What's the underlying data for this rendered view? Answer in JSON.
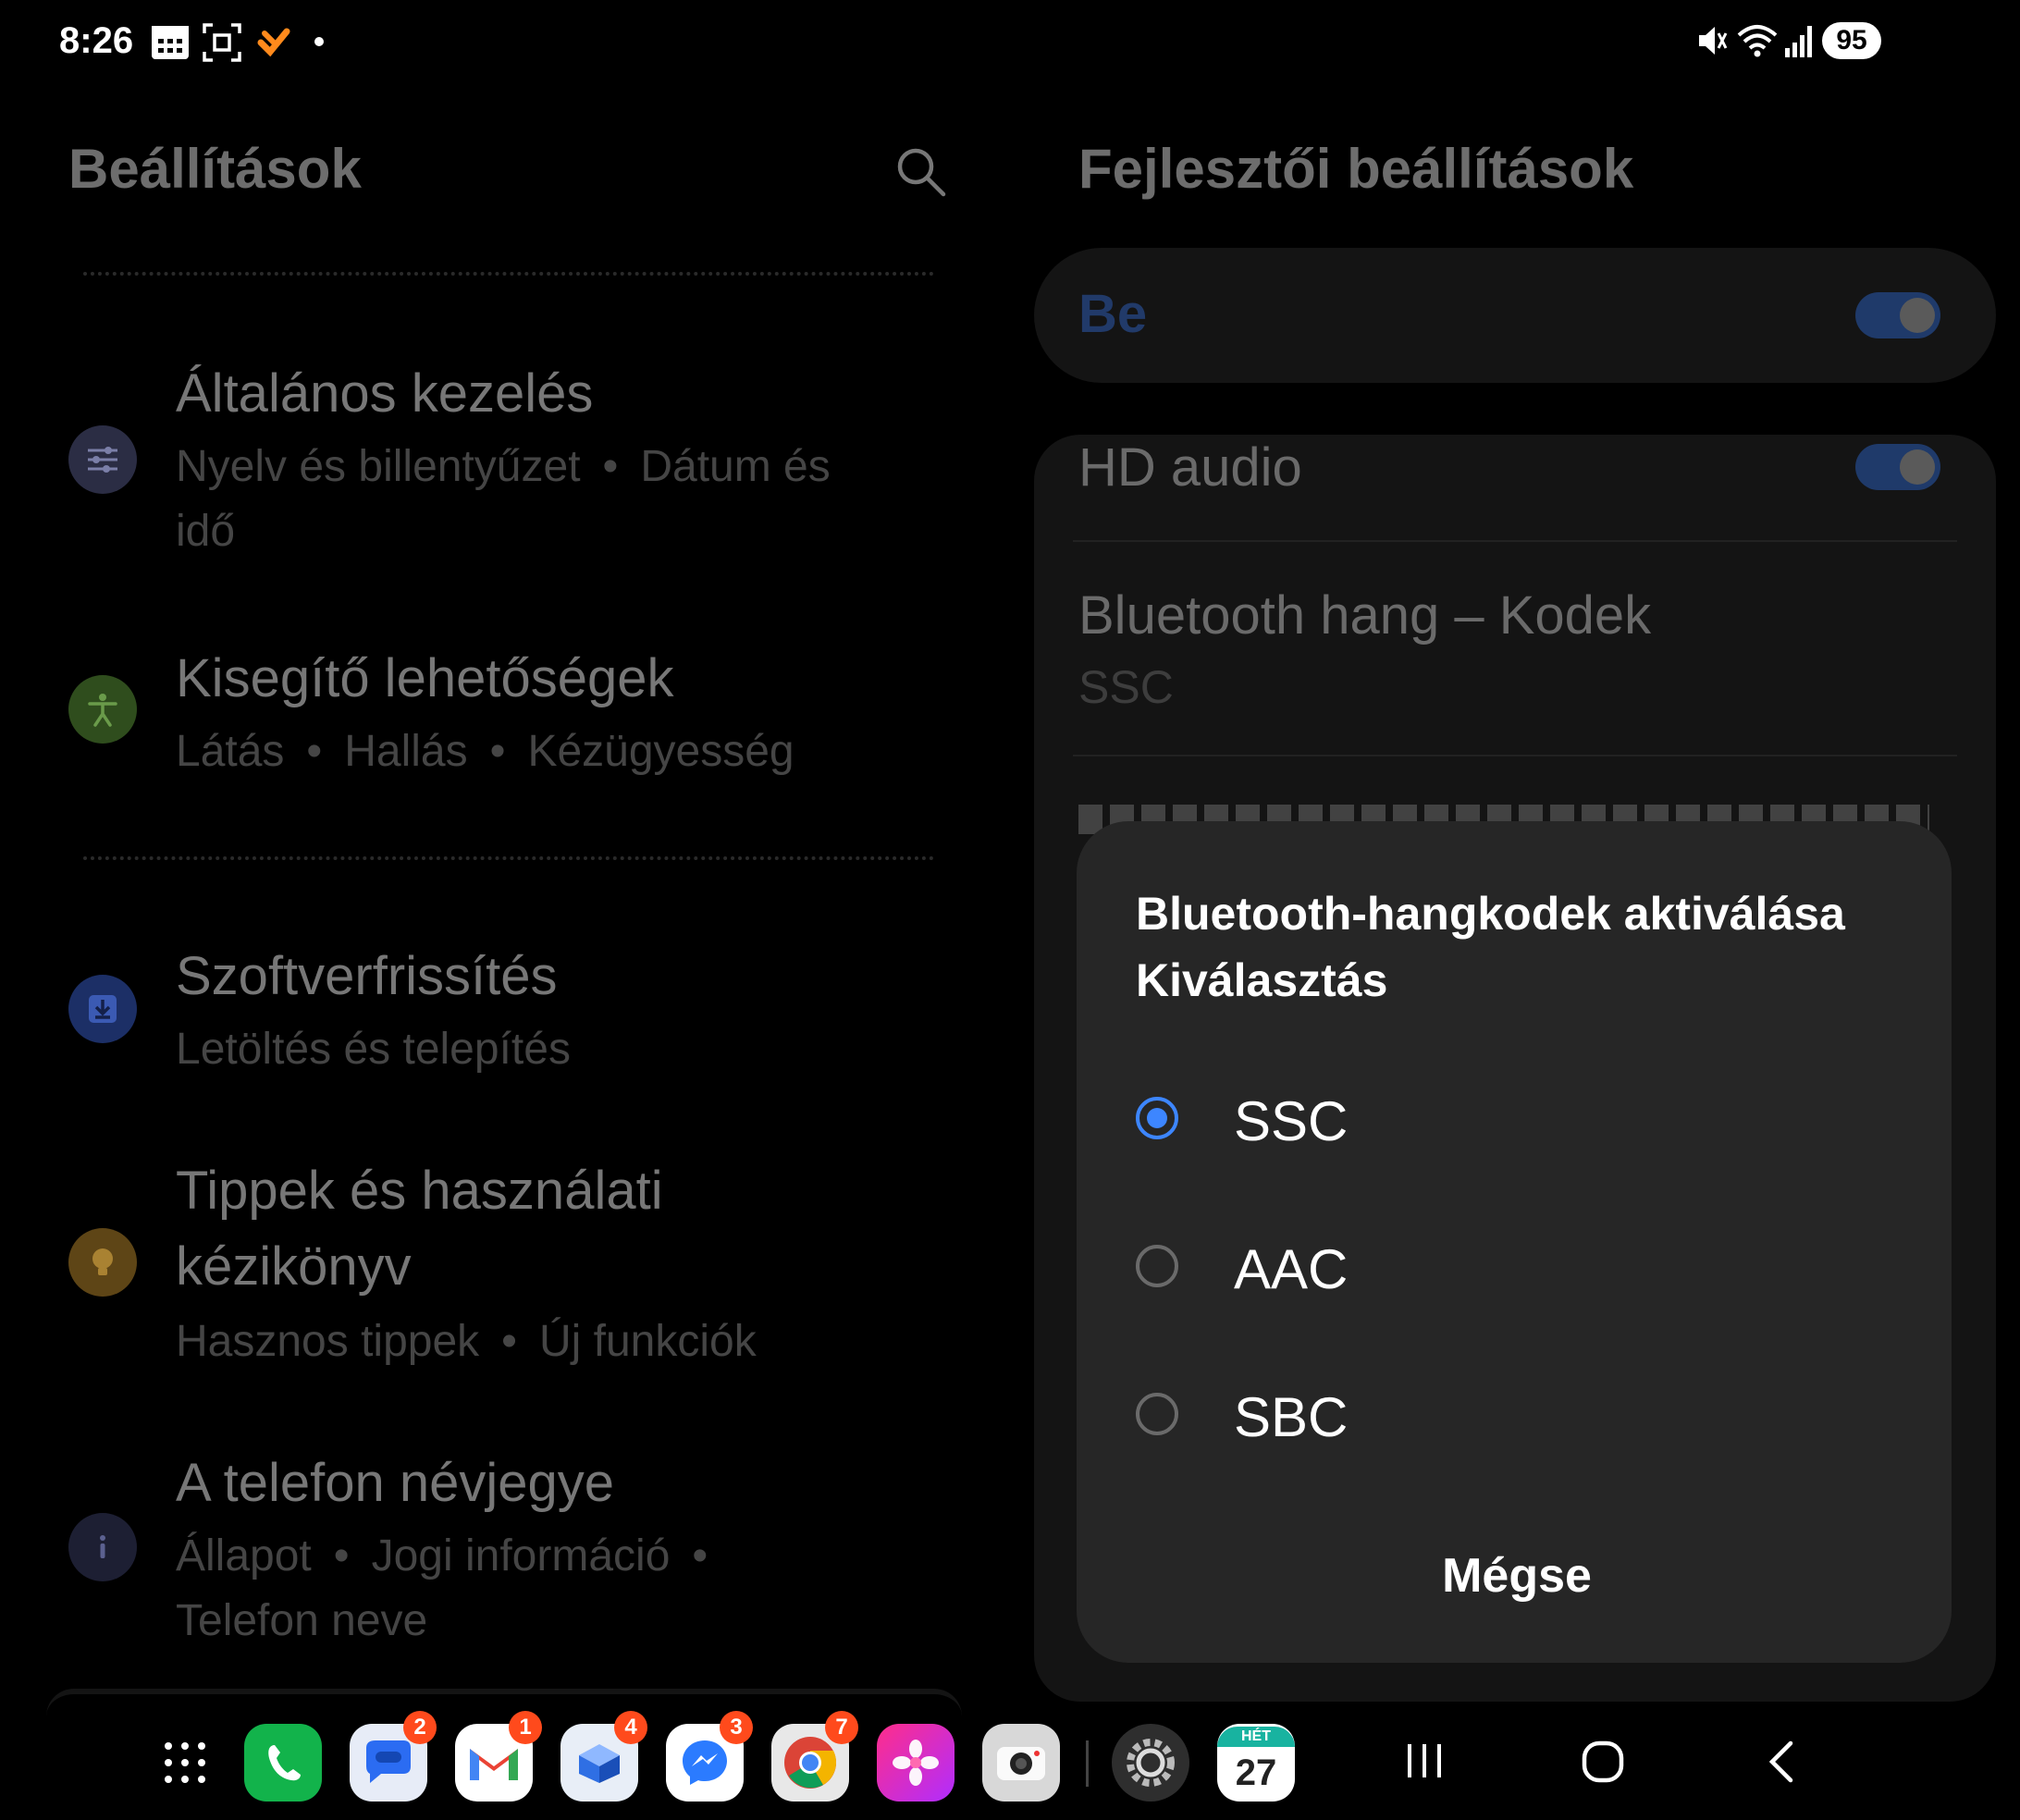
{
  "status_bar": {
    "time": "8:26",
    "left_icons": [
      "calendar-icon",
      "screenshot-icon",
      "app-notification-icon",
      "notification-dot"
    ],
    "right_icons": [
      "mute-icon",
      "wifi-icon",
      "signal-icon"
    ],
    "battery": "95"
  },
  "left_pane": {
    "title": "Beállítások",
    "items": [
      {
        "title": "Általános kezelés",
        "sub_parts": [
          "Nyelv és billentyűzet",
          "Dátum és"
        ],
        "sub_line2": "idő",
        "icon": "sliders-icon",
        "icon_color": "#2b2d44"
      },
      {
        "title": "Kisegítő lehetőségek",
        "sub_parts": [
          "Látás",
          "Hallás",
          "Kézügyesség"
        ],
        "icon": "accessibility-icon",
        "icon_color": "#2f4d1d"
      },
      {
        "title": "Szoftverfrissítés",
        "sub": "Letöltés és telepítés",
        "icon": "download-icon",
        "icon_color": "#1c2f66"
      },
      {
        "title_line1": "Tippek és használati",
        "title_line2": "kézikönyv",
        "sub_parts": [
          "Hasznos tippek",
          "Új funkciók"
        ],
        "icon": "lightbulb-icon",
        "icon_color": "#5e4516"
      },
      {
        "title": "A telefon névjegye",
        "sub_parts": [
          "Állapot",
          "Jogi információ",
          ""
        ],
        "sub_line2": "Telefon neve",
        "icon": "info-icon",
        "icon_color": "#1d1f33"
      }
    ]
  },
  "right_pane": {
    "title": "Fejlesztői beállítások",
    "master_label": "Be",
    "rows": [
      {
        "title": "HD audio"
      },
      {
        "title": "Bluetooth hang – Kodek",
        "sub": "SSC"
      }
    ]
  },
  "dialog": {
    "title": "Bluetooth-hangkodek aktiválása Kiválasztás",
    "options": [
      "SSC",
      "AAC",
      "SBC"
    ],
    "selected": "SSC",
    "cancel": "Mégse"
  },
  "dock": {
    "apps": [
      {
        "name": "app-drawer",
        "badge": ""
      },
      {
        "name": "phone",
        "badge": ""
      },
      {
        "name": "messages",
        "badge": "2"
      },
      {
        "name": "gmail",
        "badge": "1"
      },
      {
        "name": "inbox",
        "badge": "4"
      },
      {
        "name": "messenger",
        "badge": "3"
      },
      {
        "name": "chrome",
        "badge": "7"
      },
      {
        "name": "gallery",
        "badge": ""
      },
      {
        "name": "camera",
        "badge": ""
      },
      {
        "name": "settings",
        "badge": ""
      },
      {
        "name": "calendar",
        "badge": ""
      }
    ],
    "calendar_day_label": "HÉT",
    "calendar_day_number": "27",
    "accent_colors": {
      "radio": "#3d86ff",
      "toggle": "#1f3a6a",
      "badge": "#ff4a1c"
    }
  }
}
